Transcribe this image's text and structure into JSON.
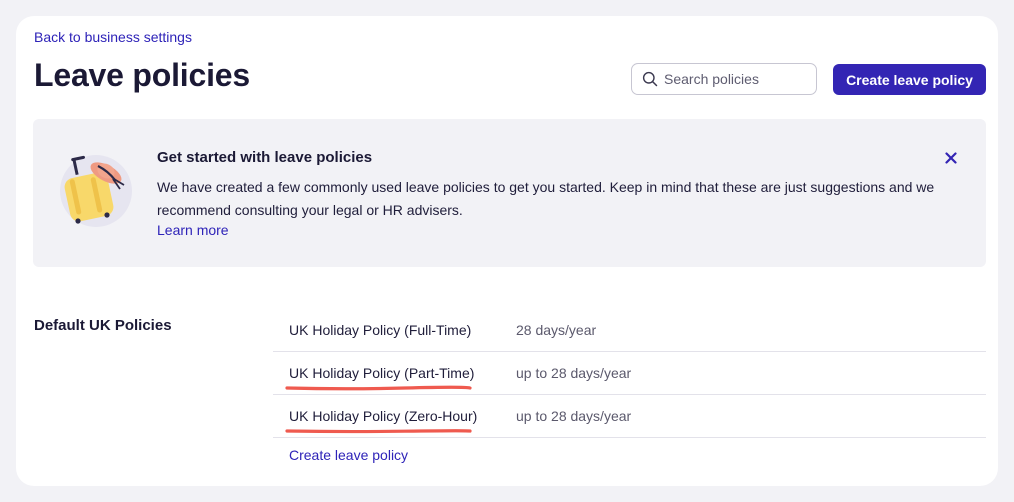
{
  "header": {
    "back_link": "Back to business settings",
    "title": "Leave policies",
    "search_placeholder": "Search policies",
    "create_button": "Create leave policy"
  },
  "banner": {
    "title": "Get started with leave policies",
    "text": "We have created a few commonly used leave policies to get you started. Keep in mind that these are just suggestions and we recommend consulting your legal or HR advisers.",
    "learn_more": "Learn more",
    "illustration_icon": "suitcase-with-sunhat-icon",
    "close_icon": "close-icon"
  },
  "section": {
    "title": "Default UK Policies",
    "policies": [
      {
        "name": "UK Holiday Policy (Full-Time)",
        "allowance": "28 days/year",
        "highlighted": false
      },
      {
        "name": "UK Holiday Policy (Part-Time)",
        "allowance": "up to 28 days/year",
        "highlighted": true
      },
      {
        "name": "UK Holiday Policy (Zero-Hour)",
        "allowance": "up to 28 days/year",
        "highlighted": true
      }
    ],
    "create_link": "Create leave policy"
  },
  "colors": {
    "accent": "#3325b4",
    "link": "#2e23b8",
    "highlight_underline": "#ef5a4f",
    "banner_bg": "#f2f2f6"
  }
}
